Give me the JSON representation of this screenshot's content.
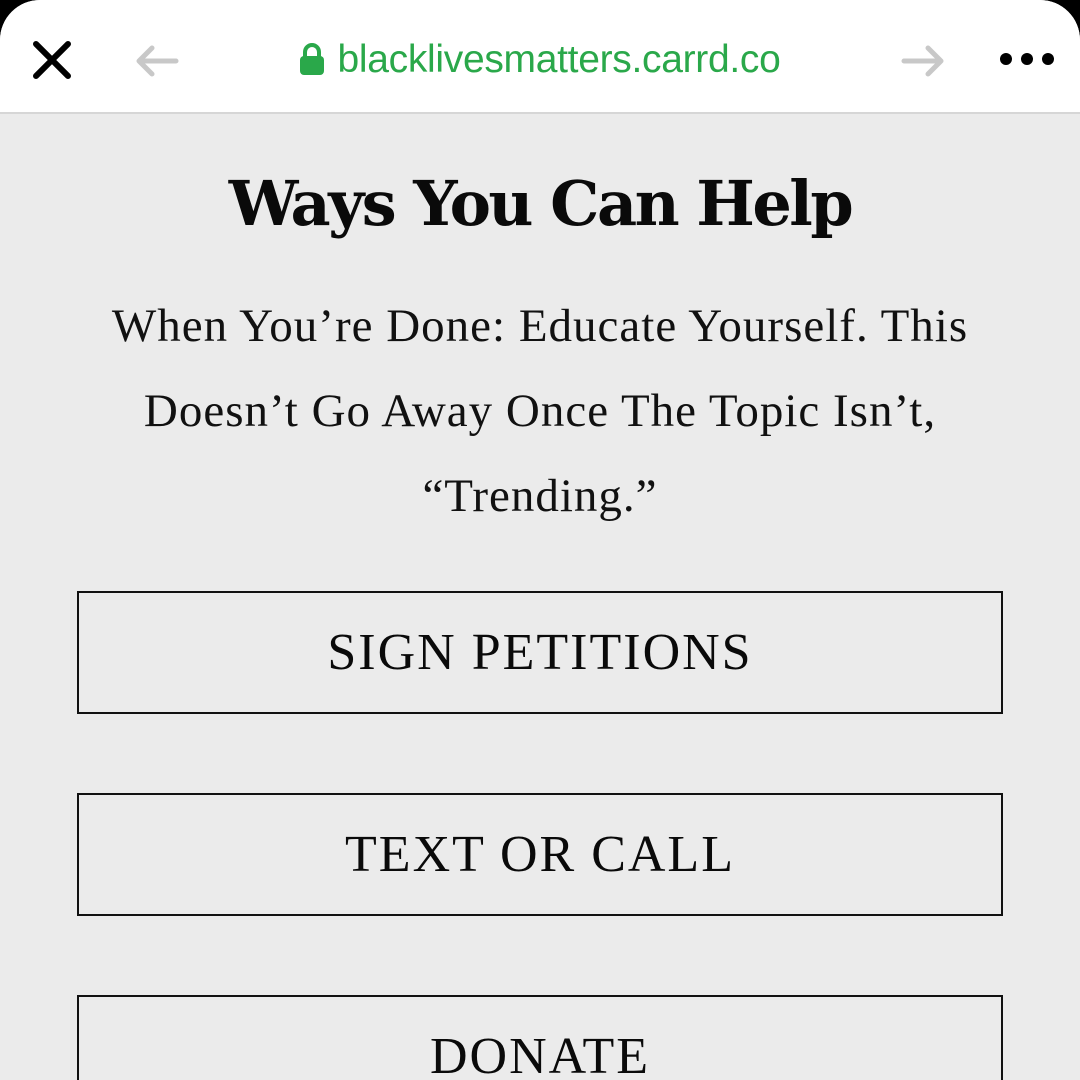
{
  "browser": {
    "url": "blacklivesmatters.carrd.co",
    "icons": {
      "close": "close-icon",
      "back": "arrow-left-icon",
      "lock": "lock-icon",
      "forward": "arrow-right-icon",
      "more": "more-dots-icon"
    },
    "colors": {
      "url": "#2aa84a",
      "nav_disabled": "#c8c8c8"
    }
  },
  "page": {
    "title": "Ways You Can Help",
    "subtitle": "When You’re Done: Educate Yourself. This Doesn’t Go Away Once The Topic Isn’t, “Trending.”",
    "buttons": [
      {
        "label": "SIGN PETITIONS"
      },
      {
        "label": "TEXT OR CALL"
      },
      {
        "label": "DONATE"
      }
    ],
    "colors": {
      "background": "#ebebeb",
      "text": "#0a0a0a"
    }
  }
}
